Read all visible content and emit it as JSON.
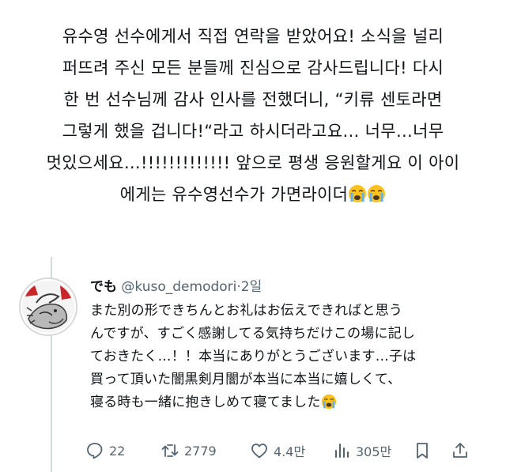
{
  "main_post": {
    "lines": [
      "유수영 선수에게서 직접 연락을 받았어요! 소식을 널리",
      "퍼뜨려 주신 모든 분들께 진심으로 감사드립니다! 다시",
      "한 번 선수님께 감사 인사를 전했더니, “키류 센토라면",
      "그렇게 했을 겁니다!“라고 하시더라고요… 너무…너무",
      "멋있으세요…!!!!!!!!!!!!! 앞으로 평생 응원할게요 이 아이",
      "에게는 유수영선수가 가면라이더"
    ],
    "trailing_emoji": "loudly-crying-face"
  },
  "reply": {
    "display_name": "でも",
    "handle": "@kuso_demodori",
    "separator": "·",
    "time": "2일",
    "lines": [
      "また別の形できちんとお礼はお伝えできればと思う",
      "んですが、すごく感謝してる気持ちだけこの場に記し",
      "ておきたく…！！本当にありがとうございます…子は",
      "買って頂いた闇黒剣月闇が本当に本当に嬉しくて、",
      "寝る時も一緒に抱きしめて寝てました"
    ],
    "trailing_emoji": "loudly-crying-face"
  },
  "actions": {
    "replies": "22",
    "reposts": "2779",
    "likes": "4.4만",
    "views": "305만"
  }
}
